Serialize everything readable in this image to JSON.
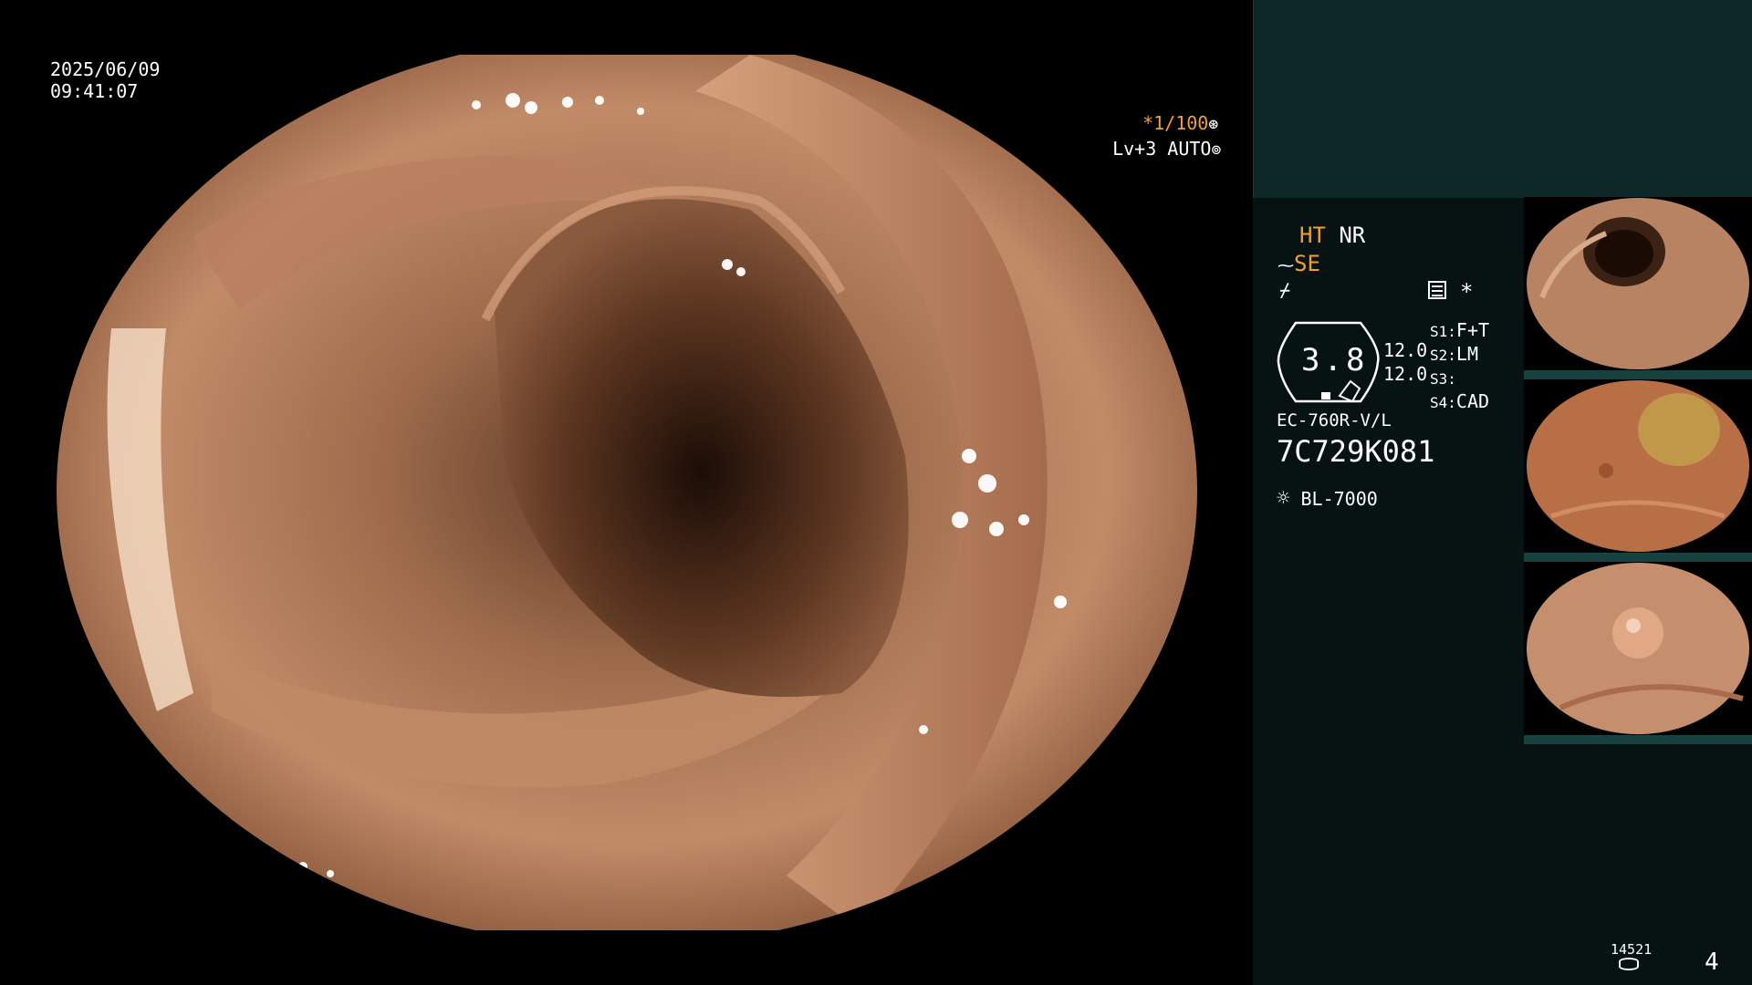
{
  "osd": {
    "date": "2025/06/09",
    "time": "09:41:07",
    "shutter": "*1/100",
    "level_label": "Lv+3 AUTO"
  },
  "panel": {
    "ht": "HT",
    "nr": "NR",
    "se": "SE",
    "memory_icon": "list-icon",
    "asterisk": "*",
    "zoom_value": "3.8",
    "val1": "12.0",
    "val2": "12.0",
    "s1_label": "S1:",
    "s1_value": "F+T",
    "s2_label": "S2:",
    "s2_value": "LM",
    "s3_label": "S3:",
    "s3_value": "",
    "s4_label": "S4:",
    "s4_value": "CAD",
    "scope_model": "EC-760R-V/L",
    "serial": "7C729K081",
    "light_source": "BL-7000"
  },
  "footer": {
    "count": "14521",
    "page": "4"
  },
  "colors": {
    "accent_yellow": "#f0a030",
    "panel_bg": "#071312",
    "panel_top_bg": "#0e2727",
    "tissue": "#b27a58"
  },
  "thumbnails": [
    {
      "name": "thumbnail-lumen"
    },
    {
      "name": "thumbnail-mucosa-debris"
    },
    {
      "name": "thumbnail-polyp"
    }
  ]
}
